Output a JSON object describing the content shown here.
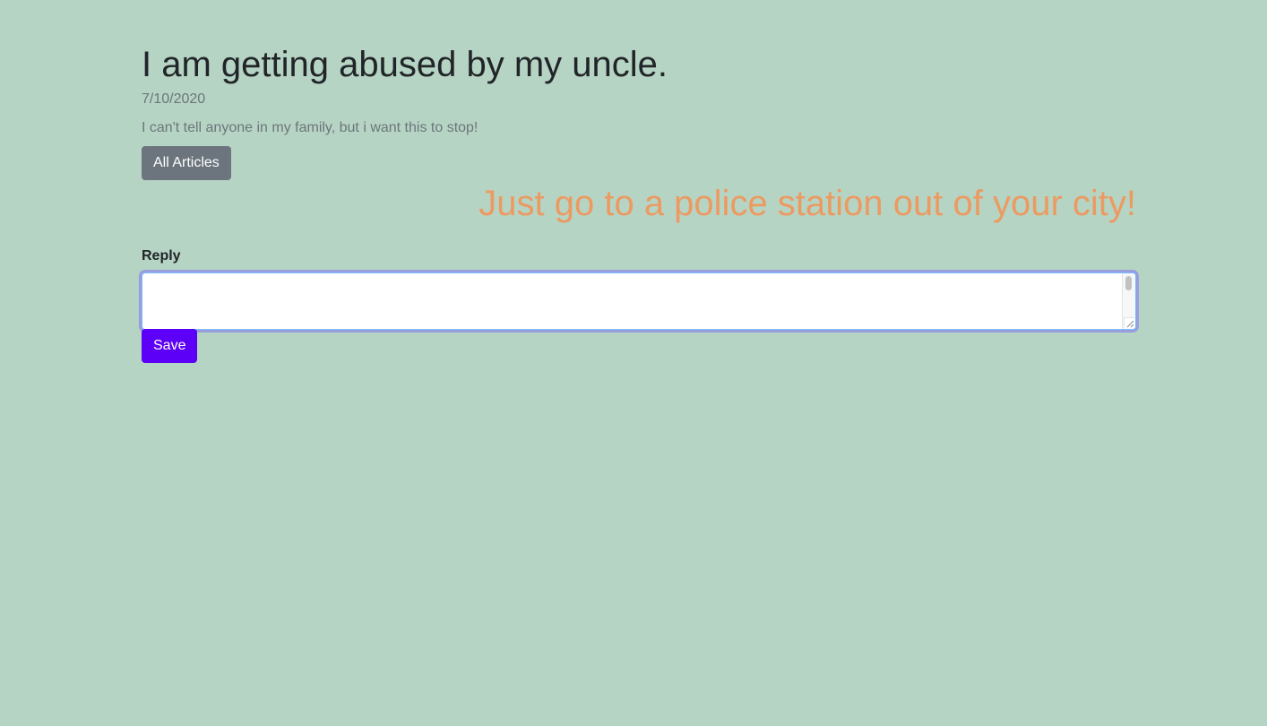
{
  "article": {
    "title": "I am getting abused by my uncle.",
    "date": "7/10/2020",
    "body": "I can't tell anyone in my family, but i want this to stop!",
    "all_articles_label": "All Articles"
  },
  "reply_shown": {
    "text": "Just go to a police station out of your city!"
  },
  "reply_form": {
    "label": "Reply",
    "value": "",
    "save_label": "Save"
  },
  "colors": {
    "background": "#b6d4c3",
    "title": "#212529",
    "muted": "#6c757d",
    "reply_text": "#ec9a62",
    "save_button": "#5d00f7",
    "articles_button": "#6c757d"
  }
}
